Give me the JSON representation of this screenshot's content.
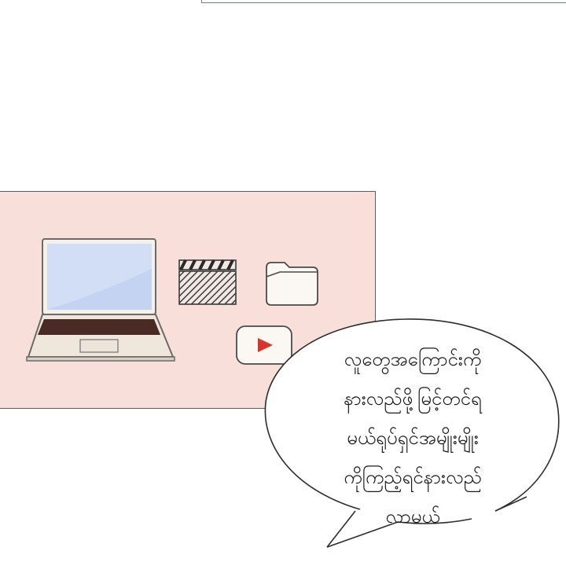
{
  "speech_bubble": {
    "lines": [
      "လူတွေအကြောင်းကို",
      "နားလည်ဖို့မြင့်တင်ရ",
      "မယ်ရုပ်ရှင်အမျိုးမျိုး",
      "ကိုကြည့်ရင်နားလည်",
      "လာမယ်"
    ]
  },
  "icons": [
    "laptop-icon",
    "clapperboard-icon",
    "folder-icon",
    "video-play-icon"
  ],
  "colors": {
    "panel_background": "#f8dfd9",
    "laptop_screen": "#c4d3f2",
    "keyboard": "#4a2a24",
    "play_button": "#d9342b"
  }
}
